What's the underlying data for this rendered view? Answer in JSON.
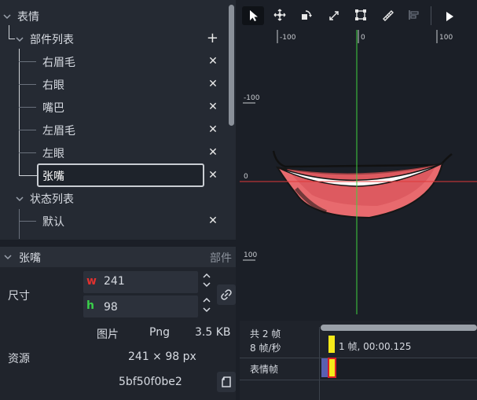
{
  "tree": {
    "root_label": "表情",
    "parts_group_label": "部件列表",
    "parts": [
      {
        "label": "右眉毛"
      },
      {
        "label": "右眼"
      },
      {
        "label": "嘴巴"
      },
      {
        "label": "左眉毛"
      },
      {
        "label": "左眼"
      },
      {
        "label": "张嘴"
      }
    ],
    "states_group_label": "状态列表",
    "states": [
      {
        "label": "默认"
      }
    ],
    "remove_glyph": "✕",
    "add_glyph": "+"
  },
  "props": {
    "title": "张嘴",
    "type_label": "部件",
    "size_label": "尺寸",
    "width_key": "w",
    "width_value": "241",
    "height_key": "h",
    "height_value": "98",
    "width_key_color": "#e0312f",
    "height_key_color": "#3ad14a",
    "resource_label": "资源",
    "image_label": "图片",
    "format": "Png",
    "file_size": "3.5 KB",
    "dimensions": "241 × 98 px",
    "hash": "5bf50f0be2"
  },
  "canvas": {
    "ruler_x": [
      "-100",
      "0",
      "100"
    ],
    "ruler_y": [
      "-100",
      "0",
      "100"
    ],
    "axis_colors": {
      "x_axis": "#e03a3a",
      "y_axis": "#3fd13f"
    },
    "tools": [
      "pointer-icon",
      "move-icon",
      "rotate-icon",
      "scale-icon",
      "bounds-icon",
      "ruler-icon",
      "align-icon",
      "play-icon"
    ]
  },
  "timeline": {
    "frame_count": "共 2 帧",
    "fps": "8 帧/秒",
    "current_frame": "1 帧, 00:00.125",
    "track_label": "表情帧",
    "marker_color": "#f6ea1a"
  }
}
